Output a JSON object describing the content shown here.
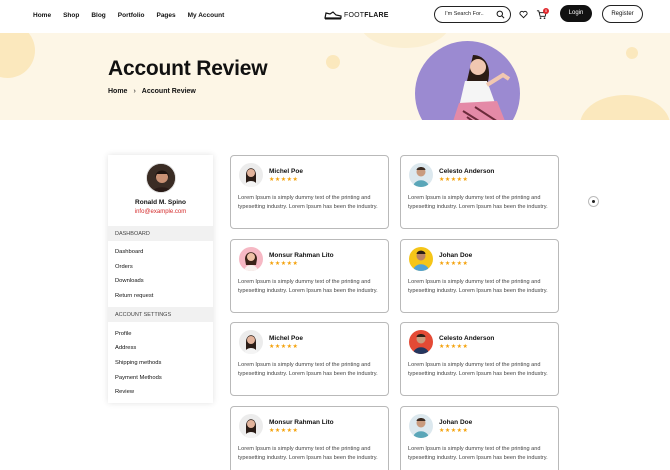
{
  "nav": {
    "items": [
      "Home",
      "Shop",
      "Blog",
      "Portfolio",
      "Pages",
      "My Account"
    ]
  },
  "logo": {
    "text_a": "FOOT",
    "text_b": "FLARE"
  },
  "search": {
    "placeholder": "I'm Search For..",
    "icon": "search-icon"
  },
  "header_actions": {
    "cart_count": "0",
    "login_label": "Login",
    "register_label": "Register"
  },
  "hero": {
    "title": "Account Review",
    "breadcrumb": [
      "Home",
      "Account Review"
    ],
    "separator": "›"
  },
  "sidebar": {
    "name": "Ronald M. Spino",
    "email": "info@example.com",
    "sections": [
      {
        "title": "DASHBOARD",
        "items": [
          "Dashboard",
          "Orders",
          "Downloads",
          "Return request"
        ]
      },
      {
        "title": "ACCOUNT SETTINGS",
        "items": [
          "Profile",
          "Address",
          "Shipping methods",
          "Payment Methods",
          "Review"
        ]
      }
    ]
  },
  "reviews": [
    {
      "name": "Michel Poe",
      "stars": "★★★★★",
      "text": "Lorem Ipsum is simply dummy text of the printing and typesetting industry. Lorem Ipsum has been the industry."
    },
    {
      "name": "Celesto Anderson",
      "stars": "★★★★★",
      "text": "Lorem Ipsum is simply dummy text of the printing and typesetting industry. Lorem Ipsum has been the industry."
    },
    {
      "name": "Monsur Rahman Lito",
      "stars": "★★★★★",
      "text": "Lorem Ipsum is simply dummy text of the printing and typesetting industry. Lorem Ipsum has been the industry."
    },
    {
      "name": "Johan Doe",
      "stars": "★★★★★",
      "text": "Lorem Ipsum is simply dummy text of the printing and typesetting industry. Lorem Ipsum has been the industry."
    },
    {
      "name": "Michel Poe",
      "stars": "★★★★★",
      "text": "Lorem Ipsum is simply dummy text of the printing and typesetting industry. Lorem Ipsum has been the industry."
    },
    {
      "name": "Celesto Anderson",
      "stars": "★★★★★",
      "text": "Lorem Ipsum is simply dummy text of the printing and typesetting industry. Lorem Ipsum has been the industry."
    },
    {
      "name": "Monsur Rahman Lito",
      "stars": "★★★★★",
      "text": "Lorem Ipsum is simply dummy text of the printing and typesetting industry. Lorem Ipsum has been the industry."
    },
    {
      "name": "Johan Doe",
      "stars": "★★★★★",
      "text": "Lorem Ipsum is simply dummy text of the printing and typesetting industry. Lorem Ipsum has been the industry."
    }
  ],
  "colors": {
    "accent_star": "#f4a20c",
    "email": "#d42c2c",
    "hero_bg": "#fdf6e6",
    "hero_photo_bg": "#9b8ad1"
  }
}
